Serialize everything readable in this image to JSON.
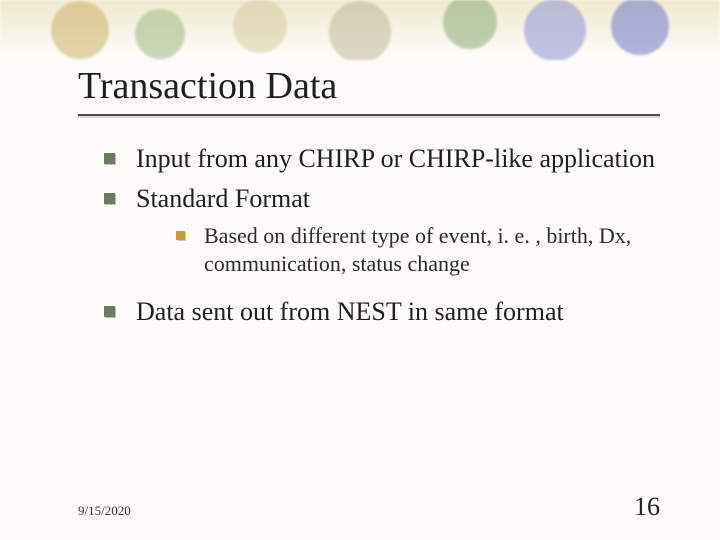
{
  "title": "Transaction Data",
  "bullets": {
    "b1": "Input from any CHIRP or CHIRP-like application",
    "b2": "Standard Format",
    "b2_sub1": "Based on different type of event, i. e. , birth, Dx, communication, status change",
    "b3": "Data sent out from NEST in same format"
  },
  "footer": {
    "date": "9/15/2020",
    "page": "16"
  }
}
